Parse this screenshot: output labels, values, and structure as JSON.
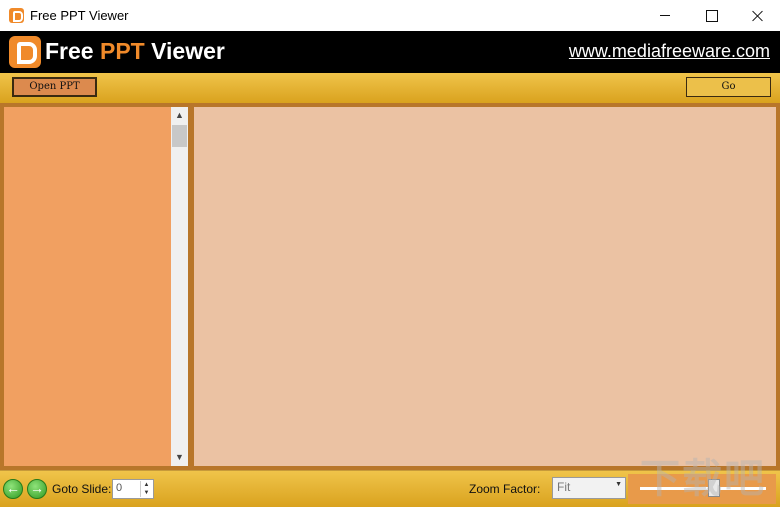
{
  "window": {
    "title": "Free PPT Viewer",
    "icon": "ppt-app-icon"
  },
  "banner": {
    "title_part1": "Free ",
    "title_part2": "PPT",
    "title_part3": " Viewer",
    "link": "www.mediafreeware.com",
    "accent_color": "#f08a2a"
  },
  "toolbar": {
    "open_label": "Open PPT",
    "go_label": "Go"
  },
  "bottom": {
    "goto_label": "Goto Slide:",
    "goto_value": "0",
    "zoom_label": "Zoom Factor:",
    "zoom_value": "Fit",
    "watermark": "下载吧"
  },
  "colors": {
    "toolbar_gold": "#e0ac2c",
    "slide_list_bg": "#f1a061",
    "viewer_bg": "#ebc2a3"
  }
}
